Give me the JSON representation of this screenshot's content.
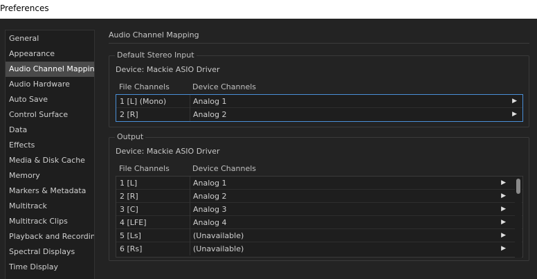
{
  "window": {
    "title": "Preferences"
  },
  "sidebar": {
    "items": [
      {
        "label": "General"
      },
      {
        "label": "Appearance"
      },
      {
        "label": "Audio Channel Mapping"
      },
      {
        "label": "Audio Hardware"
      },
      {
        "label": "Auto Save"
      },
      {
        "label": "Control Surface"
      },
      {
        "label": "Data"
      },
      {
        "label": "Effects"
      },
      {
        "label": "Media & Disk Cache"
      },
      {
        "label": "Memory"
      },
      {
        "label": "Markers & Metadata"
      },
      {
        "label": "Multitrack"
      },
      {
        "label": "Multitrack Clips"
      },
      {
        "label": "Playback and Recording"
      },
      {
        "label": "Spectral Displays"
      },
      {
        "label": "Time Display"
      }
    ],
    "selected": "Audio Channel Mapping"
  },
  "main": {
    "heading": "Audio Channel Mapping",
    "input_group": {
      "legend": "Default Stereo Input",
      "device": "Device: Mackie ASIO Driver",
      "col_file": "File Channels",
      "col_device": "Device Channels",
      "rows": [
        {
          "file": "1 [L] (Mono)",
          "device": "Analog 1"
        },
        {
          "file": "2 [R]",
          "device": "Analog 2"
        }
      ]
    },
    "output_group": {
      "legend": "Output",
      "device": "Device: Mackie ASIO Driver",
      "col_file": "File Channels",
      "col_device": "Device Channels",
      "rows": [
        {
          "file": "1 [L]",
          "device": "Analog 1"
        },
        {
          "file": "2 [R]",
          "device": "Analog 2"
        },
        {
          "file": "3 [C]",
          "device": "Analog 3"
        },
        {
          "file": "4 [LFE]",
          "device": "Analog 4"
        },
        {
          "file": "5 [Ls]",
          "device": "(Unavailable)"
        },
        {
          "file": "6 [Rs]",
          "device": "(Unavailable)"
        }
      ]
    },
    "row_arrow_icon": "triangle-right-icon"
  },
  "colors": {
    "background": "#232323",
    "sidebar_selected": "#4a4a4a",
    "focus_border": "#4a90d9"
  }
}
